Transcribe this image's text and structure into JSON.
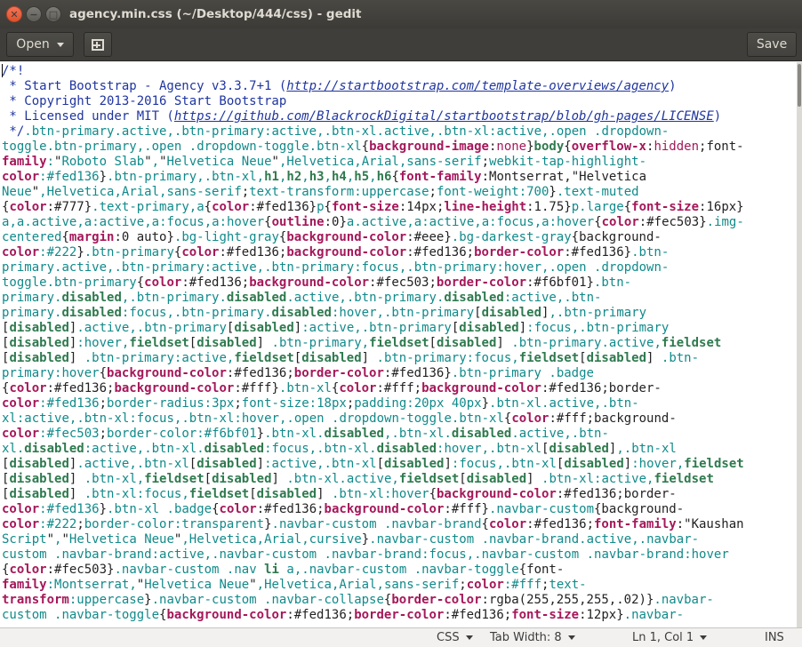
{
  "window": {
    "title": "agency.min.css (~/Desktop/444/css) - gedit",
    "close_glyph": "✕",
    "minimize_glyph": "−",
    "maximize_glyph": "□"
  },
  "headerbar": {
    "open_label": "Open",
    "save_label": "Save",
    "new_tab_icon": "new-tab-icon"
  },
  "editor": {
    "lines": [
      "/*!",
      " * Start Bootstrap - Agency v3.3.7+1 (http://startbootstrap.com/template-overviews/agency)",
      " * Copyright 2013-2016 Start Bootstrap",
      " * Licensed under MIT (https://github.com/BlackrockDigital/startbootstrap/blob/gh-pages/LICENSE)",
      " */.btn-primary.active,.btn-primary:active,.btn-xl.active,.btn-xl:active,.open .dropdown-",
      "toggle.btn-primary,.open .dropdown-toggle.btn-xl{background-image:none}body{overflow-x:hidden;font-",
      "family:\"Roboto Slab\",\"Helvetica Neue\",Helvetica,Arial,sans-serif;webkit-tap-highlight-",
      "color:#fed136}.btn-primary,.btn-xl,h1,h2,h3,h4,h5,h6{font-family:Montserrat,\"Helvetica",
      "Neue\",Helvetica,Arial,sans-serif;text-transform:uppercase;font-weight:700}.text-muted",
      "{color:#777}.text-primary,a{color:#fed136}p{font-size:14px;line-height:1.75}p.large{font-size:16px}",
      "a,a.active,a:active,a:focus,a:hover{outline:0}a.active,a:active,a:focus,a:hover{color:#fec503}.img-",
      "centered{margin:0 auto}.bg-light-gray{background-color:#eee}.bg-darkest-gray{background-",
      "color:#222}.btn-primary{color:#fed136;background-color:#fed136;border-color:#fed136}.btn-",
      "primary.active,.btn-primary:active,.btn-primary:focus,.btn-primary:hover,.open .dropdown-",
      "toggle.btn-primary{color:#fed136;background-color:#fec503;border-color:#f6bf01}.btn-",
      "primary.disabled,.btn-primary.disabled.active,.btn-primary.disabled:active,.btn-",
      "primary.disabled:focus,.btn-primary.disabled:hover,.btn-primary[disabled],.btn-primary",
      "[disabled].active,.btn-primary[disabled]:active,.btn-primary[disabled]:focus,.btn-primary",
      "[disabled]:hover,fieldset[disabled] .btn-primary,fieldset[disabled] .btn-primary.active,fieldset",
      "[disabled] .btn-primary:active,fieldset[disabled] .btn-primary:focus,fieldset[disabled] .btn-",
      "primary:hover{background-color:#fed136;border-color:#fed136}.btn-primary .badge",
      "{color:#fed136;background-color:#fff}.btn-xl{color:#fff;background-color:#fed136;border-",
      "color:#fed136;border-radius:3px;font-size:18px;padding:20px 40px}.btn-xl.active,.btn-",
      "xl:active,.btn-xl:focus,.btn-xl:hover,.open .dropdown-toggle.btn-xl{color:#fff;background-",
      "color:#fec503;border-color:#f6bf01}.btn-xl.disabled,.btn-xl.disabled.active,.btn-",
      "xl.disabled:active,.btn-xl.disabled:focus,.btn-xl.disabled:hover,.btn-xl[disabled],.btn-xl",
      "[disabled].active,.btn-xl[disabled]:active,.btn-xl[disabled]:focus,.btn-xl[disabled]:hover,fieldset",
      "[disabled] .btn-xl,fieldset[disabled] .btn-xl.active,fieldset[disabled] .btn-xl:active,fieldset",
      "[disabled] .btn-xl:focus,fieldset[disabled] .btn-xl:hover{background-color:#fed136;border-",
      "color:#fed136}.btn-xl .badge{color:#fed136;background-color:#fff}.navbar-custom{background-",
      "color:#222;border-color:transparent}.navbar-custom .navbar-brand{color:#fed136;font-family:\"Kaushan",
      "Script\",\"Helvetica Neue\",Helvetica,Arial,cursive}.navbar-custom .navbar-brand.active,.navbar-",
      "custom .navbar-brand:active,.navbar-custom .navbar-brand:focus,.navbar-custom .navbar-brand:hover",
      "{color:#fec503}.navbar-custom .nav li a,.navbar-custom .navbar-toggle{font-",
      "family:Montserrat,\"Helvetica Neue\",Helvetica,Arial,sans-serif;color:#fff;text-",
      "transform:uppercase}.navbar-custom .navbar-collapse{border-color:rgba(255,255,255,.02)}.navbar-",
      "custom .navbar-toggle{background-color:#fed136;border-color:#fed136;font-size:12px}.navbar-"
    ]
  },
  "statusbar": {
    "language": "CSS",
    "tab_width": "Tab Width: 8",
    "position": "Ln 1, Col 1",
    "mode": "INS"
  },
  "colors": {
    "comment": "#1f35a0",
    "property": "#a5185a",
    "tag": "#2f7a4f",
    "selector": "#118a8a"
  }
}
